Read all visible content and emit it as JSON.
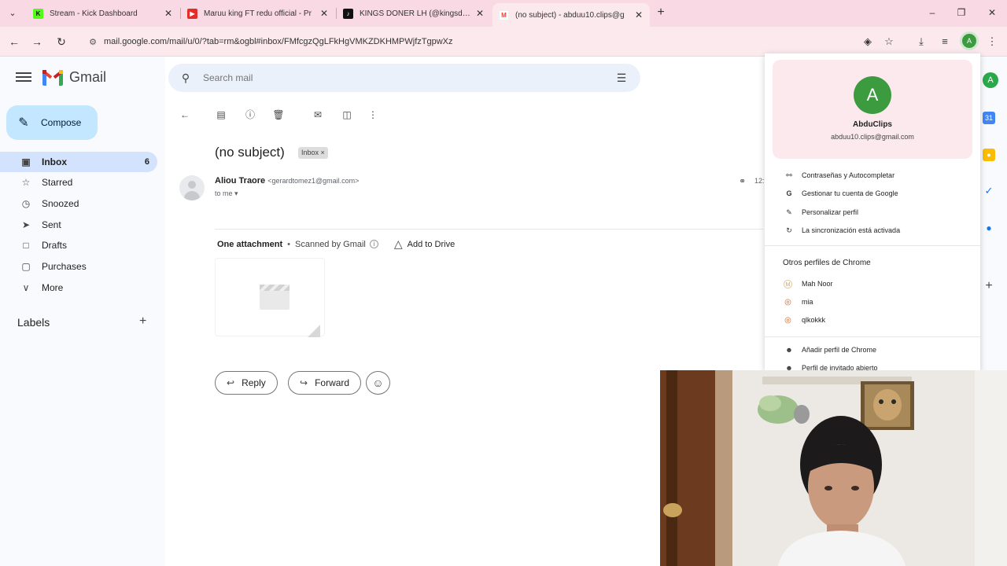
{
  "browser": {
    "tabs": [
      {
        "title": "Stream - Kick Dashboard",
        "favicon_color": "#1a1a1a",
        "favicon_letter": "K",
        "active": false
      },
      {
        "title": "Maruu king FT redu official - Pr",
        "favicon_color": "#e52d27",
        "favicon_letter": "▶",
        "active": false
      },
      {
        "title": "KINGS DONER LH (@kingsdone",
        "favicon_color": "#111111",
        "favicon_letter": "♪",
        "active": false
      },
      {
        "title": "(no subject) - abduu10.clips@g",
        "favicon_color": "#ea4335",
        "favicon_letter": "M",
        "active": true
      }
    ],
    "url": "mail.google.com/mail/u/0/?tab=rm&ogbl#inbox/FMfcgzQgLFkHgVMKZDKHMPWjfzTgpwXz",
    "profile_letter": "A"
  },
  "gmail": {
    "logo_text": "Gmail",
    "search_placeholder": "Search mail",
    "compose_label": "Compose",
    "nav": [
      {
        "label": "Inbox",
        "count": "6",
        "icon": "inbox-icon",
        "glyph": "▣",
        "active": true
      },
      {
        "label": "Starred",
        "count": "",
        "icon": "star-icon",
        "glyph": "☆",
        "active": false
      },
      {
        "label": "Snoozed",
        "count": "",
        "icon": "clock-icon",
        "glyph": "◷",
        "active": false
      },
      {
        "label": "Sent",
        "count": "",
        "icon": "send-icon",
        "glyph": "➤",
        "active": false
      },
      {
        "label": "Drafts",
        "count": "",
        "icon": "draft-icon",
        "glyph": "□",
        "active": false
      },
      {
        "label": "Purchases",
        "count": "",
        "icon": "bag-icon",
        "glyph": "▢",
        "active": false
      },
      {
        "label": "More",
        "count": "",
        "icon": "chevron-down-icon",
        "glyph": "∨",
        "active": false
      }
    ],
    "labels_heading": "Labels"
  },
  "message": {
    "subject": "(no subject)",
    "label_chip": "Inbox",
    "sender_name": "Aliou Traore",
    "sender_email": "<gerardtomez1@gmail.com>",
    "to_line": "to me",
    "time_partial": "12:",
    "attachment_title": "One attachment",
    "scanned_text": "Scanned by Gmail",
    "add_to_drive": "Add to Drive",
    "reply_label": "Reply",
    "forward_label": "Forward"
  },
  "profile_menu": {
    "name": "AbduClips",
    "email": "abduu10.clips@gmail.com",
    "avatar_letter": "A",
    "items": [
      "Contraseñas y Autocompletar",
      "Gestionar tu cuenta de Google",
      "Personalizar perfil",
      "La sincronización está activada"
    ],
    "other_heading": "Otros perfiles de Chrome",
    "other_profiles": [
      {
        "name": "Mah Noor",
        "letter": "M",
        "color": "#e8c9a0"
      },
      {
        "name": "mia",
        "letter": "◎",
        "color": "#c26a3a"
      },
      {
        "name": "qlkokkk",
        "letter": "◎",
        "color": "#c26a3a"
      }
    ],
    "footer": [
      "Añadir perfil de Chrome",
      "Perfil de invitado abierto"
    ]
  },
  "colors": {
    "tabstrip": "#f9d9e3",
    "accent_green": "#3c9a3f",
    "compose_bg": "#c2e7ff",
    "active_nav": "#d3e3fd"
  }
}
